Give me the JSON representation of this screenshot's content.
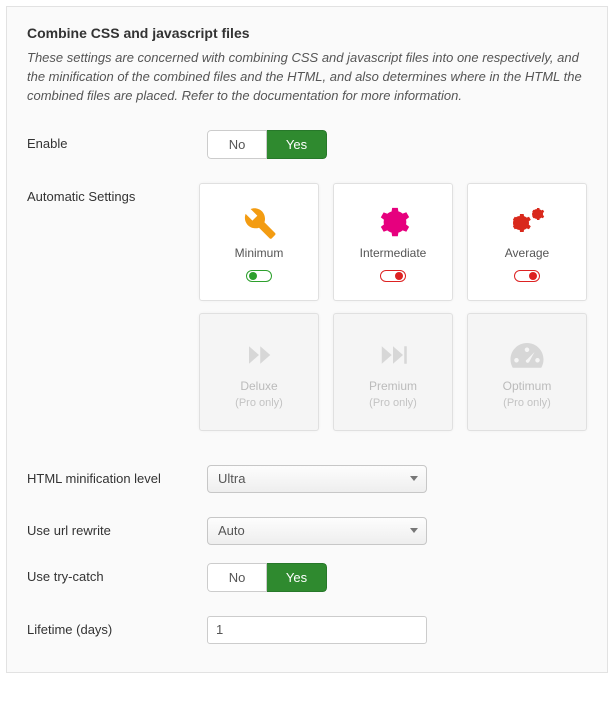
{
  "title": "Combine CSS and javascript files",
  "description": "These settings are concerned with combining CSS and javascript files into one respectively, and the minification of the combined files and the HTML, and also determines where in the HTML the combined files are placed. Refer to the documentation for more information.",
  "labels": {
    "enable": "Enable",
    "automatic_settings": "Automatic Settings",
    "html_min_level": "HTML minification level",
    "use_url_rewrite": "Use url rewrite",
    "use_try_catch": "Use try-catch",
    "lifetime": "Lifetime (days)"
  },
  "toggle": {
    "no": "No",
    "yes": "Yes"
  },
  "cards": {
    "minimum": "Minimum",
    "intermediate": "Intermediate",
    "average": "Average",
    "deluxe": "Deluxe",
    "premium": "Premium",
    "optimum": "Optimum",
    "pro_only": "(Pro only)"
  },
  "html_min_level_value": "Ultra",
  "use_url_rewrite_value": "Auto",
  "lifetime_value": "1"
}
